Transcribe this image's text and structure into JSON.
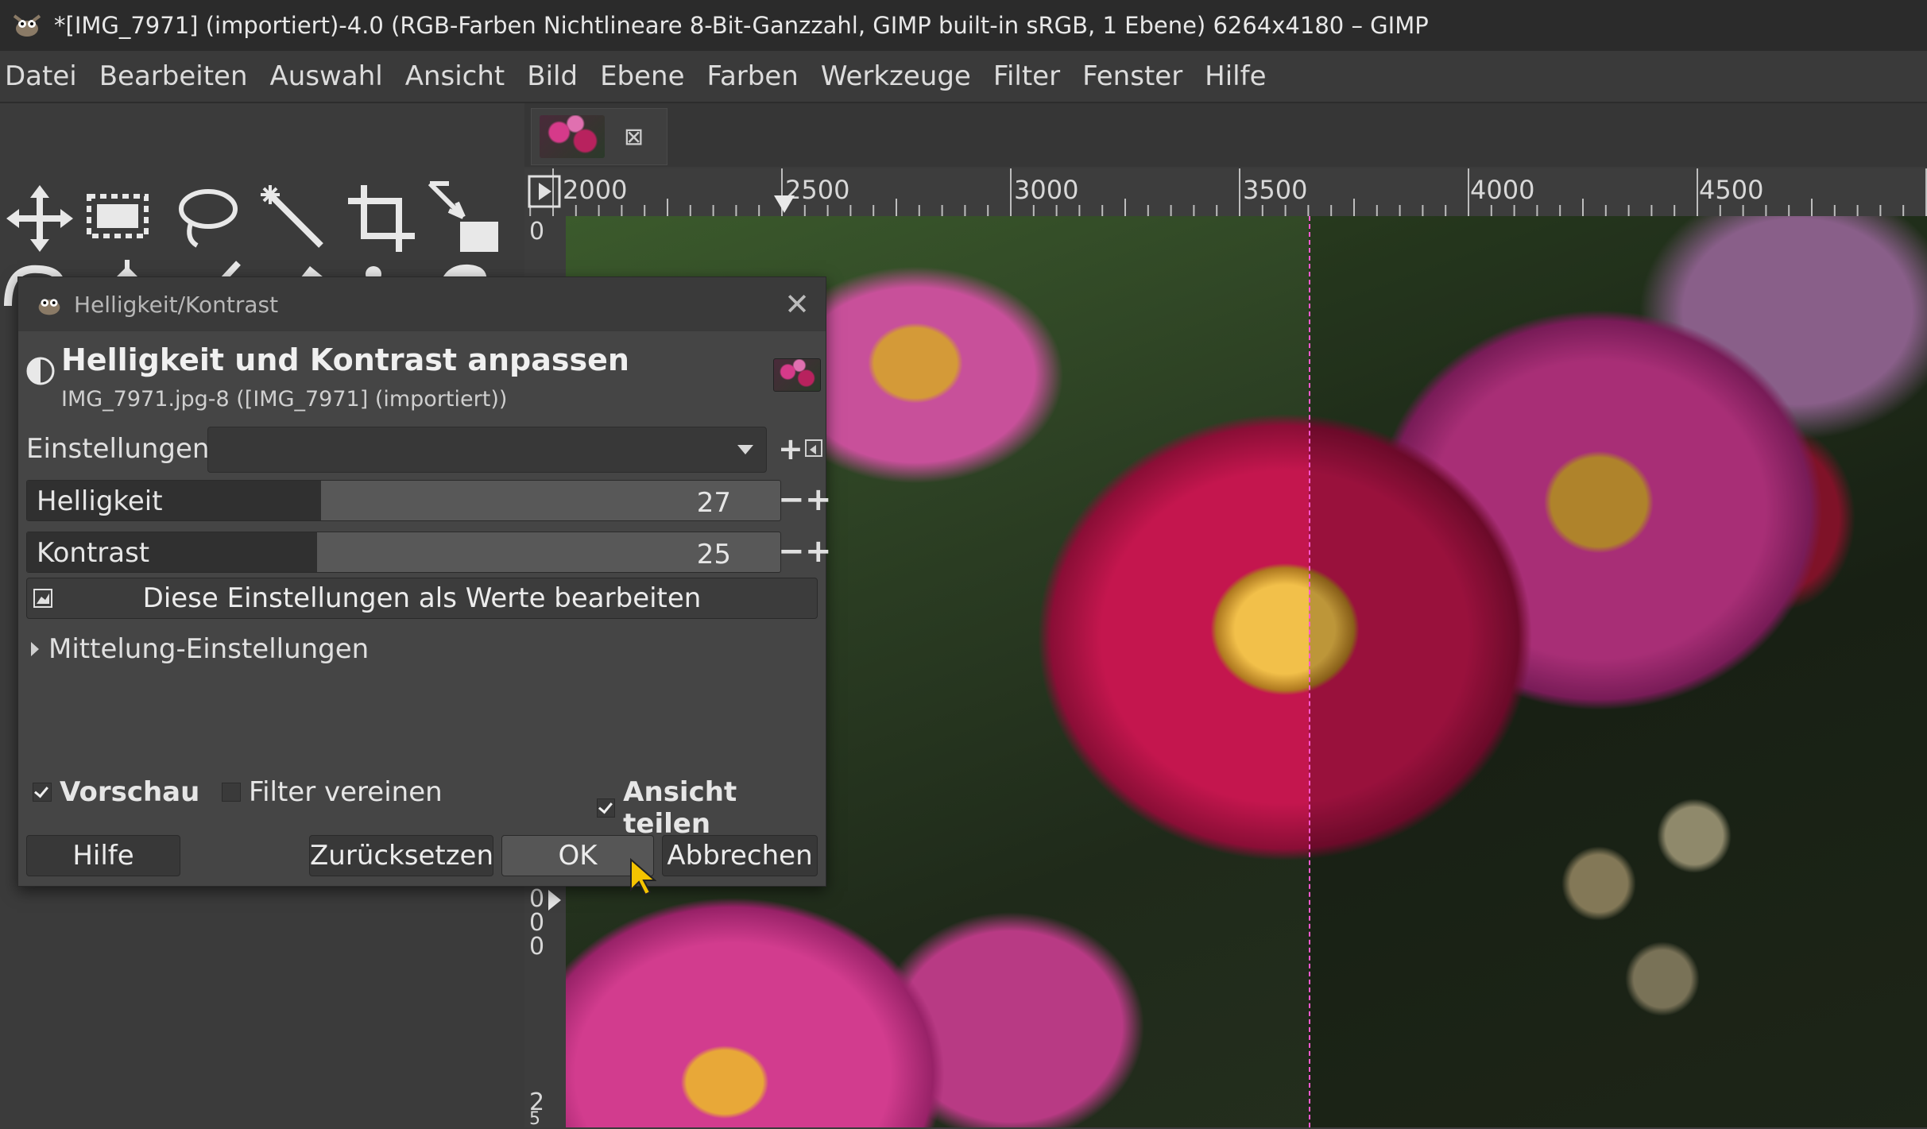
{
  "window": {
    "title": "*[IMG_7971] (importiert)-4.0 (RGB-Farben Nichtlineare 8-Bit-Ganzzahl, GIMP built-in sRGB, 1 Ebene) 6264x4180 – GIMP"
  },
  "menubar": {
    "items": [
      "Datei",
      "Bearbeiten",
      "Auswahl",
      "Ansicht",
      "Bild",
      "Ebene",
      "Farben",
      "Werkzeuge",
      "Filter",
      "Fenster",
      "Hilfe"
    ]
  },
  "canvas": {
    "ruler_top_labels": [
      "2000",
      "2500",
      "3000",
      "3500",
      "4000",
      "4500"
    ],
    "ruler_left_labels": [
      "0",
      "0",
      "0",
      "0",
      "2",
      "5"
    ]
  },
  "dialog": {
    "title": "Helligkeit/Kontrast",
    "heading": "Helligkeit und Kontrast anpassen",
    "subheading": "IMG_7971.jpg-8 ([IMG_7971] (importiert))",
    "settings_label": "Einstellungen:",
    "settings_value": "",
    "sliders": [
      {
        "label": "Helligkeit",
        "value": "27",
        "fraction": 0.39
      },
      {
        "label": "Kontrast",
        "value": "25",
        "fraction": 0.385
      }
    ],
    "edit_values_label": "Diese Einstellungen als Werte bearbeiten",
    "blending_label": "Mittelung-Einstellungen",
    "preview_label": "Vorschau",
    "preview_checked": true,
    "merge_label": "Filter vereinen",
    "merge_checked": false,
    "split_label": "Ansicht teilen",
    "split_checked": true,
    "buttons": {
      "help": "Hilfe",
      "reset": "Zurücksetzen",
      "ok": "OK",
      "cancel": "Abbrechen"
    }
  },
  "colors": {
    "accent_split_line": "#ff5ad2",
    "dialog_bg": "#454545",
    "slider_fill": "#303030"
  }
}
